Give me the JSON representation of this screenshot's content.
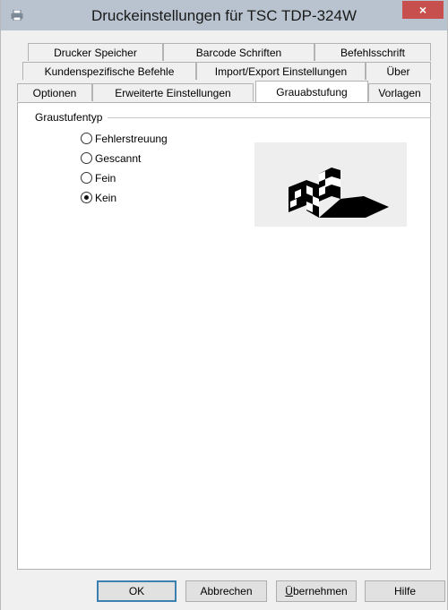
{
  "window": {
    "title": "Druckeinstellungen für TSC TDP-324W",
    "close_glyph": "×"
  },
  "tabs": {
    "row1": [
      {
        "label": "Drucker Speicher"
      },
      {
        "label": "Barcode Schriften"
      },
      {
        "label": "Befehlsschrift"
      }
    ],
    "row2": [
      {
        "label": "Kundenspezifische Befehle"
      },
      {
        "label": "Import/Export Einstellungen"
      },
      {
        "label": "Über"
      }
    ],
    "row3": [
      {
        "label": "Optionen"
      },
      {
        "label": "Erweiterte Einstellungen"
      },
      {
        "label": "Grauabstufung",
        "active": true
      },
      {
        "label": "Vorlagen"
      }
    ]
  },
  "grayscale": {
    "group_label": "Graustufentyp",
    "options": [
      {
        "label": "Fehlerstreuung",
        "checked": false
      },
      {
        "label": "Gescannt",
        "checked": false
      },
      {
        "label": "Fein",
        "checked": false
      },
      {
        "label": "Kein",
        "checked": true
      }
    ]
  },
  "buttons": {
    "ok": "OK",
    "cancel": "Abbrechen",
    "apply_prefix": "Ü",
    "apply_rest": "bernehmen",
    "help": "Hilfe"
  },
  "icons": {
    "title_icon": "printer-icon",
    "close_icon": "close-icon",
    "preview": "grayscale-preview-image"
  }
}
